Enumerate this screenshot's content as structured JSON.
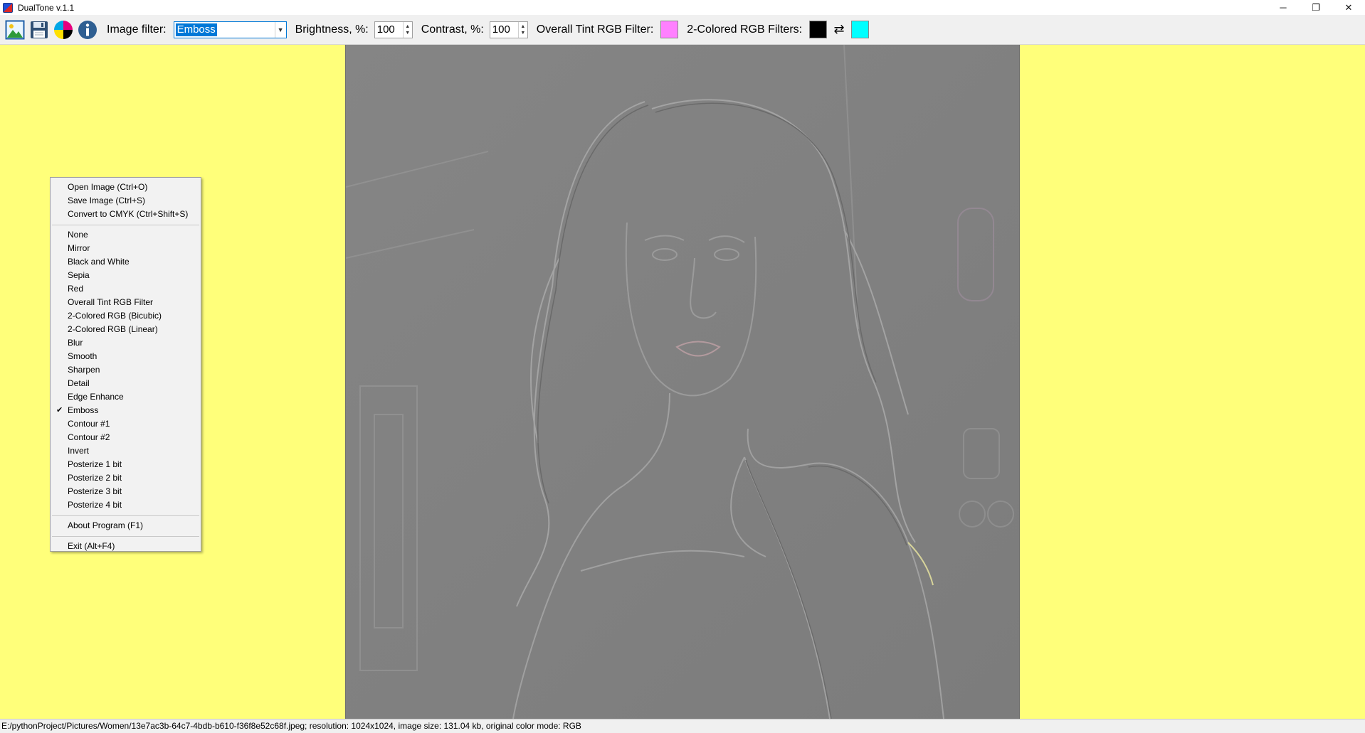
{
  "window": {
    "title": "DualTone v.1.1",
    "controls": [
      "─",
      "❐",
      "✕"
    ]
  },
  "toolbar": {
    "icons": [
      "open-image-icon",
      "save-icon",
      "cmyk-icon",
      "info-icon"
    ],
    "image_filter_label": "Image filter:",
    "image_filter_value": "Emboss",
    "brightness_label": "Brightness, %:",
    "brightness_value": "100",
    "contrast_label": "Contrast, %:",
    "contrast_value": "100",
    "tint_label": "Overall Tint RGB Filter:",
    "tint_color": "#ff80ff",
    "two_colored_label": "2-Colored RGB Filters:",
    "two_color_a": "#000000",
    "two_color_b": "#00ffff",
    "swap_glyph": "⇄"
  },
  "colors": {
    "canvas_background": "#ffff7a",
    "selection": "#0078d7"
  },
  "menu": {
    "file_items": [
      "Open Image (Ctrl+O)",
      "Save Image (Ctrl+S)",
      "Convert to CMYK (Ctrl+Shift+S)"
    ],
    "filter_items": [
      "None",
      "Mirror",
      "Black and White",
      "Sepia",
      "Red",
      "Overall Tint RGB Filter",
      "2-Colored RGB (Bicubic)",
      "2-Colored RGB (Linear)",
      "Blur",
      "Smooth",
      "Sharpen",
      "Detail",
      "Edge Enhance",
      "Emboss",
      "Contour #1",
      "Contour #2",
      "Invert",
      "Posterize 1 bit",
      "Posterize 2 bit",
      "Posterize 3 bit",
      "Posterize 4 bit"
    ],
    "checked_item": "Emboss",
    "check_glyph": "✔",
    "about_item": "About Program (F1)",
    "exit_item": "Exit (Alt+F4)"
  },
  "status": {
    "text": "E:/pythonProject/Pictures/Women/13e7ac3b-64c7-4bdb-b610-f36f8e52c68f.jpeg; resolution: 1024x1024, image size: 131.04 kb, original color mode: RGB"
  }
}
